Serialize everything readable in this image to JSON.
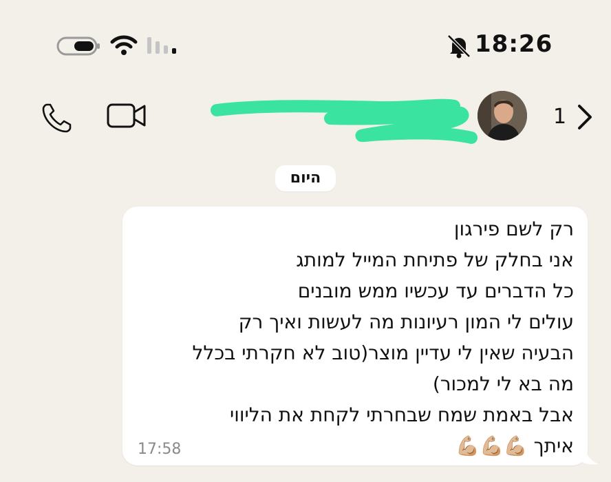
{
  "status_bar": {
    "time": "18:26",
    "icons": [
      "battery-icon",
      "wifi-icon",
      "cellular-signal-icon",
      "bell-off-icon"
    ]
  },
  "header": {
    "unread_count": "1",
    "icons": [
      "back-chevron-icon",
      "phone-icon",
      "video-camera-icon"
    ],
    "contact_name_redacted": true,
    "redaction_color": "#3be3a0"
  },
  "chat": {
    "date_label": "היום",
    "message": {
      "lines": [
        "רק לשם פירגון",
        "אני בחלק של פתיחת המייל למותג",
        "כל הדברים עד עכשיו ממש מובנים",
        "עולים לי המון רעיונות מה לעשות ואיך רק",
        "הבעיה שאין לי עדיין מוצר(טוב לא חקרתי בכלל",
        "מה בא לי למכור)",
        "אבל באמת שמח שבחרתי לקחת את הליווי",
        "איתך 💪🏼💪🏼💪🏼"
      ],
      "time": "17:58"
    }
  },
  "colors": {
    "background": "#f3efe9",
    "bubble": "#ffffff",
    "timestamp": "#8a8a8a"
  }
}
